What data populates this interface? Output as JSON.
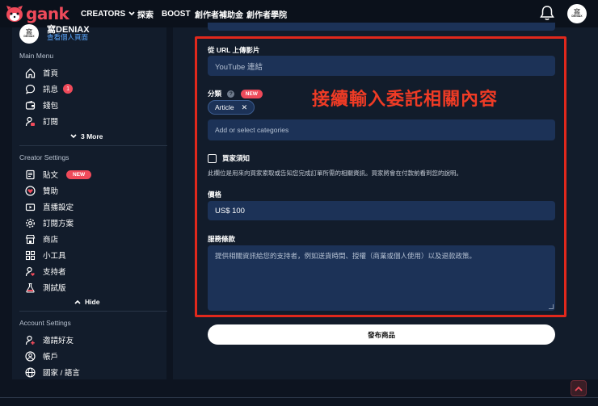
{
  "brand": {
    "name": "gank",
    "color": "#ef4a5a"
  },
  "nav": {
    "creators": "CREATORS",
    "explore": "探索",
    "boost": "BOOST",
    "fund": "創作者補助金",
    "academy": "創作者學院"
  },
  "user": {
    "avatar_text": "窩",
    "avatar_sub": "DENIAX",
    "name": "窩DENIAX",
    "profile_link": "查看個人頁面"
  },
  "sidebar": {
    "main_menu_title": "Main Menu",
    "main_items": [
      {
        "label": "首頁",
        "icon": "home-icon"
      },
      {
        "label": "訊息",
        "icon": "chat-icon",
        "badge": "1"
      },
      {
        "label": "錢包",
        "icon": "wallet-icon"
      },
      {
        "label": "訂閱",
        "icon": "subscriber-icon"
      }
    ],
    "more_label": "3 More",
    "creator_settings_title": "Creator Settings",
    "creator_items": [
      {
        "label": "貼文",
        "icon": "post-icon",
        "badge": "NEW"
      },
      {
        "label": "贊助",
        "icon": "heart-icon"
      },
      {
        "label": "直播設定",
        "icon": "stream-icon"
      },
      {
        "label": "訂閱方案",
        "icon": "gear-icon"
      },
      {
        "label": "商店",
        "icon": "shop-icon"
      },
      {
        "label": "小工具",
        "icon": "widget-icon"
      },
      {
        "label": "支持者",
        "icon": "supporter-icon"
      },
      {
        "label": "測試版",
        "icon": "beta-icon"
      }
    ],
    "hide_label": "Hide",
    "account_settings_title": "Account Settings",
    "account_items": [
      {
        "label": "邀請好友",
        "icon": "invite-icon"
      },
      {
        "label": "帳戶",
        "icon": "account-icon"
      },
      {
        "label": "國家 / 語言",
        "icon": "globe-icon"
      }
    ]
  },
  "form": {
    "url_label": "從 URL 上傳影片",
    "url_placeholder": "YouTube 連結",
    "category_label": "分類",
    "category_help": "?",
    "category_new": "NEW",
    "category_chip": "Article",
    "category_placeholder": "Add or select categories",
    "buyer_notice_label": "買家須知",
    "buyer_notice_note": "此欄位是用來向買家索取或告知您完成訂單所需的相關資訊。買家將會在付款前看到您的說明。",
    "price_label": "價格",
    "price_value": "US$  100",
    "terms_label": "服務條款",
    "terms_placeholder": "提供相關資訊給您的支持者，例如送貨時間、授權（商業或個人使用）以及退款政策。",
    "publish_label": "發布商品"
  },
  "annotation": {
    "text": "接續輸入委託相關內容",
    "color": "#ef3b25"
  }
}
